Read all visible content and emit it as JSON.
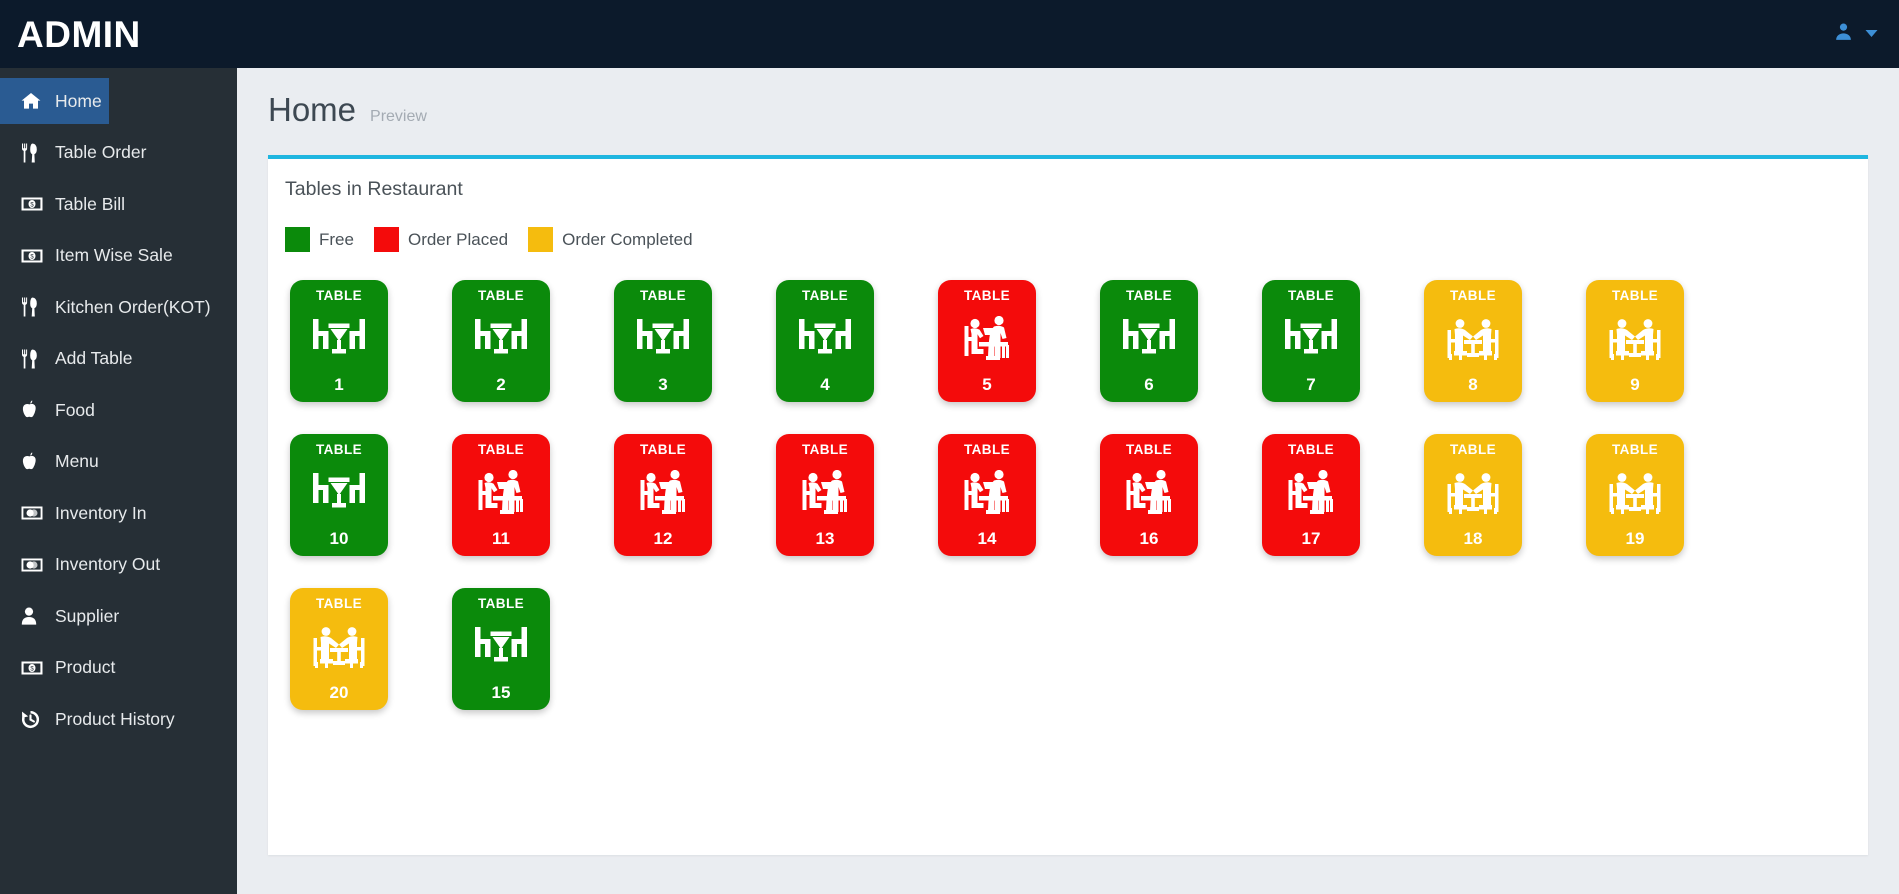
{
  "topbar": {
    "brand": "ADMIN",
    "user_icon": "user-icon",
    "caret_icon": "chevron-down-icon"
  },
  "sidebar": {
    "items": [
      {
        "label": "Home",
        "icon": "home-icon",
        "active": true
      },
      {
        "label": "Table Order",
        "icon": "cutlery-icon",
        "active": false
      },
      {
        "label": "Table Bill",
        "icon": "money-bill-icon",
        "active": false
      },
      {
        "label": "Item Wise Sale",
        "icon": "money-bill-icon",
        "active": false
      },
      {
        "label": "Kitchen Order(KOT)",
        "icon": "cutlery-icon",
        "active": false
      },
      {
        "label": "Add Table",
        "icon": "cutlery-icon",
        "active": false
      },
      {
        "label": "Food",
        "icon": "apple-icon",
        "active": false
      },
      {
        "label": "Menu",
        "icon": "apple-icon",
        "active": false
      },
      {
        "label": "Inventory In",
        "icon": "credit-card-icon",
        "active": false
      },
      {
        "label": "Inventory Out",
        "icon": "credit-card-icon",
        "active": false
      },
      {
        "label": "Supplier",
        "icon": "user-solid-icon",
        "active": false
      },
      {
        "label": "Product",
        "icon": "money-bill-icon",
        "active": false
      },
      {
        "label": "Product History",
        "icon": "history-icon",
        "active": false
      }
    ]
  },
  "page": {
    "title": "Home",
    "subtitle": "Preview"
  },
  "card": {
    "title": "Tables in Restaurant",
    "accent_color": "#1fb6e0"
  },
  "legend": [
    {
      "label": "Free",
      "color": "#0b8a0b",
      "status": "free"
    },
    {
      "label": "Order Placed",
      "color": "#f40b0b",
      "status": "placed"
    },
    {
      "label": "Order Completed",
      "color": "#f5bc0e",
      "status": "completed"
    }
  ],
  "status_colors": {
    "free": "#0b8a0b",
    "placed": "#f40b0b",
    "completed": "#f5bc0e"
  },
  "tile_word": "TABLE",
  "tables": [
    [
      {
        "number": "1",
        "status": "free"
      },
      {
        "number": "2",
        "status": "free"
      },
      {
        "number": "3",
        "status": "free"
      },
      {
        "number": "4",
        "status": "free"
      },
      {
        "number": "5",
        "status": "placed"
      },
      {
        "number": "6",
        "status": "free"
      },
      {
        "number": "7",
        "status": "free"
      },
      {
        "number": "8",
        "status": "completed"
      },
      {
        "number": "9",
        "status": "completed"
      }
    ],
    [
      {
        "number": "10",
        "status": "free"
      },
      {
        "number": "11",
        "status": "placed"
      },
      {
        "number": "12",
        "status": "placed"
      },
      {
        "number": "13",
        "status": "placed"
      },
      {
        "number": "14",
        "status": "placed"
      },
      {
        "number": "16",
        "status": "placed"
      },
      {
        "number": "17",
        "status": "placed"
      },
      {
        "number": "18",
        "status": "completed"
      },
      {
        "number": "19",
        "status": "completed"
      }
    ],
    [
      {
        "number": "20",
        "status": "completed"
      },
      {
        "number": "15",
        "status": "free"
      }
    ]
  ]
}
